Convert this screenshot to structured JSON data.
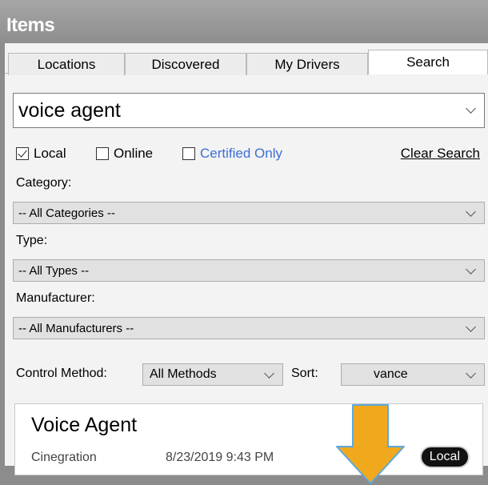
{
  "header": {
    "title": "Items"
  },
  "tabs": [
    {
      "label": "Locations",
      "active": false
    },
    {
      "label": "Discovered",
      "active": false
    },
    {
      "label": "My Drivers",
      "active": false
    },
    {
      "label": "Search",
      "active": true
    }
  ],
  "search": {
    "value": "voice agent"
  },
  "filters": {
    "local": {
      "label": "Local",
      "checked": true
    },
    "online": {
      "label": "Online",
      "checked": false
    },
    "certified": {
      "label": "Certified Only",
      "checked": false
    },
    "clear_label": "Clear Search"
  },
  "category": {
    "label": "Category:",
    "selected": "-- All Categories --"
  },
  "type": {
    "label": "Type:",
    "selected": "-- All Types --"
  },
  "manufacturer": {
    "label": "Manufacturer:",
    "selected": "-- All Manufacturers --"
  },
  "control": {
    "label": "Control Method:",
    "selected": "All Methods"
  },
  "sort": {
    "label": "Sort:",
    "selected": "vance"
  },
  "result": {
    "title": "Voice Agent",
    "manufacturer": "Cinegration",
    "date": "8/23/2019 9:43 PM",
    "badge": "Local"
  },
  "colors": {
    "accent_link": "#3b6fd8",
    "arrow": "#f0a81c",
    "arrow_outline": "#5aa8e0"
  },
  "icons": {
    "pointer": "down-arrow-icon",
    "dropdown": "chevron-down-icon",
    "check": "checkmark-icon"
  }
}
